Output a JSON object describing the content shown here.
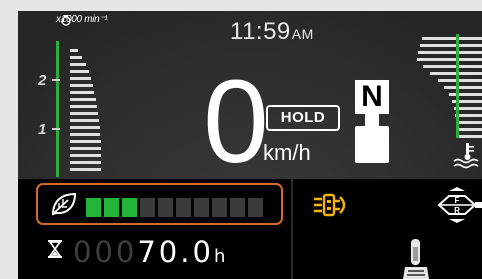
{
  "tachometer": {
    "unit_label": "x1000 min⁻¹",
    "tick_labels": [
      "2",
      "1"
    ],
    "accent_green": "#2fae3c"
  },
  "clock": {
    "time": "11:59",
    "ampm": "AM"
  },
  "speedometer": {
    "value": "0",
    "unit": "km/h",
    "hold_label": "HOLD"
  },
  "gear": {
    "indicator": "N"
  },
  "eco": {
    "total_segments": 10,
    "lit_segments": 3,
    "lit_color": "#23b43a",
    "dim_color": "#3b3b3b",
    "frame_color": "#d36a26"
  },
  "hour_meter": {
    "dim_digits": "000",
    "lit_digits": "70.0",
    "unit": "h"
  },
  "indicators": {
    "left_icon": "differential-lock-icon",
    "right_icon": "fr-shuttle-icon",
    "bottom_icon": "hydraulic-lever-icon",
    "right_badge_top": "F",
    "right_badge_bottom": "R",
    "amber": "#f4b400"
  },
  "right_gauge_icon": "coolant-temperature-icon"
}
